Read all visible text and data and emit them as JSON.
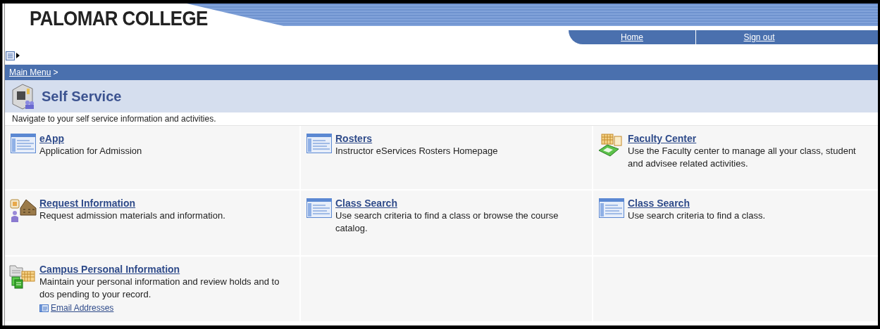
{
  "header": {
    "logo": "PALOMAR COLLEGE",
    "nav": [
      "Home",
      "Sign out"
    ]
  },
  "breadcrumb": {
    "link": "Main Menu",
    "separator": ">"
  },
  "page_title": "Self Service",
  "description": "Navigate to your self service information and activities.",
  "items": [
    {
      "kind": "page",
      "title": "eApp",
      "text": "Application for Admission"
    },
    {
      "kind": "page",
      "title": "Rosters",
      "text": "Instructor eServices Rosters Homepage"
    },
    {
      "kind": "faculty",
      "title": "Faculty Center",
      "text": "Use the Faculty center to manage all your class, student and advisee related activities."
    },
    {
      "kind": "request",
      "title": "Request Information",
      "text": "Request admission materials and information."
    },
    {
      "kind": "page",
      "title": "Class Search",
      "text": "Use search criteria to find a class or browse the course catalog."
    },
    {
      "kind": "page",
      "title": "Class Search",
      "text": "Use search criteria to find a class."
    },
    {
      "kind": "folder",
      "title": "Campus Personal Information",
      "text": "Maintain your personal information and review holds and to dos pending to your record.",
      "links": [
        "Email Addresses"
      ]
    }
  ]
}
